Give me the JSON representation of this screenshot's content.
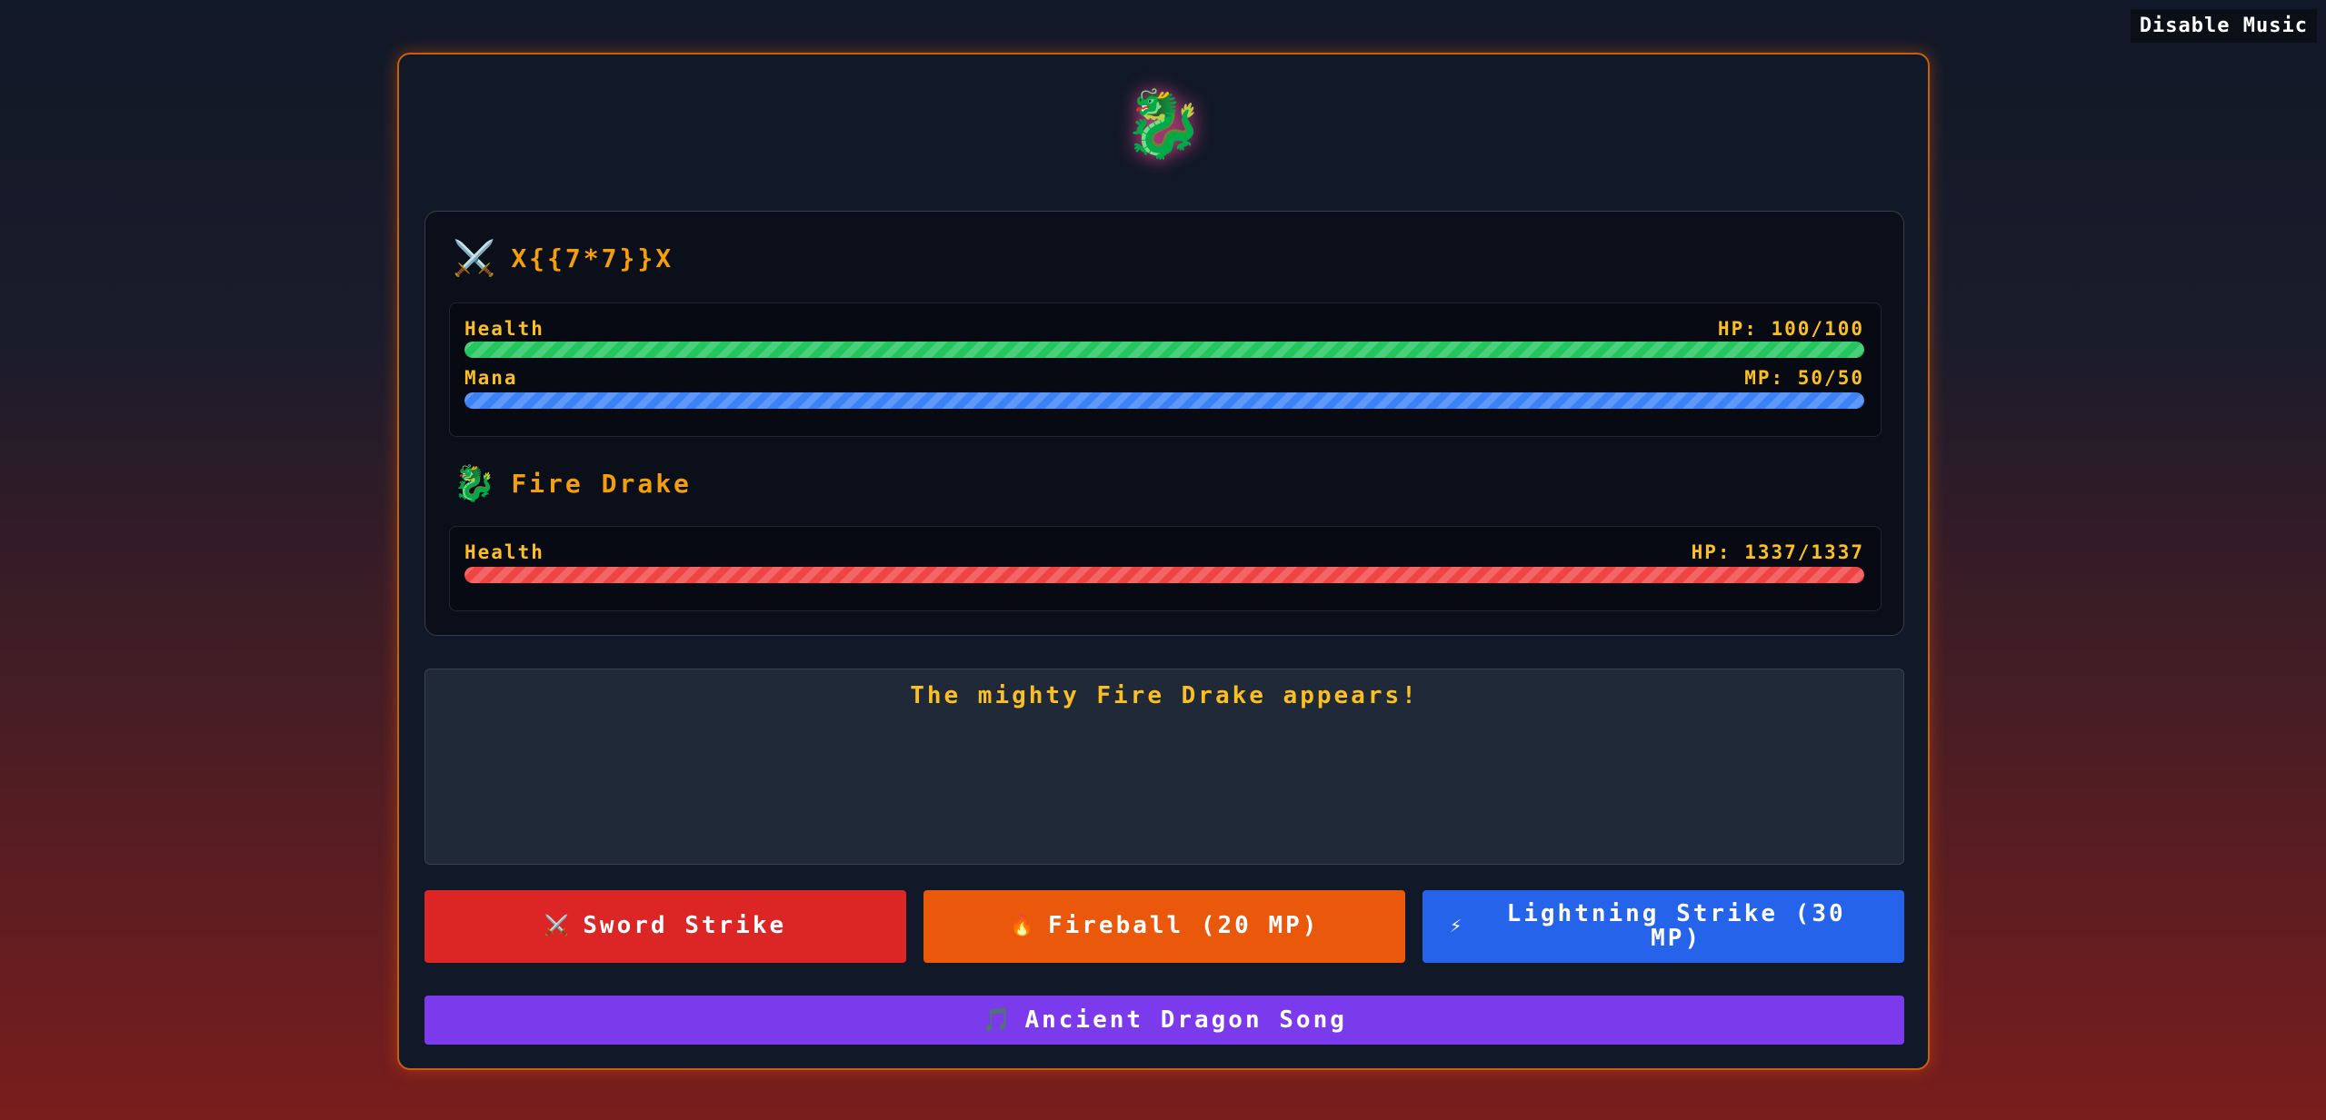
{
  "music": {
    "toggle_label": "Disable Music"
  },
  "boss_emblem": "🐉",
  "player": {
    "icon": "⚔️",
    "name": "X{{7*7}}X",
    "health": {
      "label": "Health",
      "value_text": "HP: 100/100",
      "fraction": 1.0,
      "color": "#22c55e"
    },
    "mana": {
      "label": "Mana",
      "value_text": "MP: 50/50",
      "fraction": 1.0,
      "color": "#3b82f6"
    }
  },
  "enemy": {
    "icon": "🐉",
    "name": "Fire Drake",
    "health": {
      "label": "Health",
      "value_text": "HP: 1337/1337",
      "fraction": 1.0,
      "color": "#ef4444"
    }
  },
  "battle_log": {
    "lines": [
      "The mighty Fire Drake appears!"
    ]
  },
  "actions": [
    {
      "icon": "⚔️",
      "label": "Sword Strike",
      "color": "#dc2626"
    },
    {
      "icon": "🔥",
      "label": "Fireball (20 MP)",
      "color": "#ea580c"
    },
    {
      "icon": "⚡",
      "label": "Lightning Strike (30 MP)",
      "color": "#2563eb"
    }
  ],
  "special_action": {
    "icon": "🎵",
    "label": "Ancient Dragon Song",
    "color": "#7c3aed"
  },
  "theme": {
    "frame_border": "#c2620e",
    "text_gold": "#fbbf24"
  }
}
